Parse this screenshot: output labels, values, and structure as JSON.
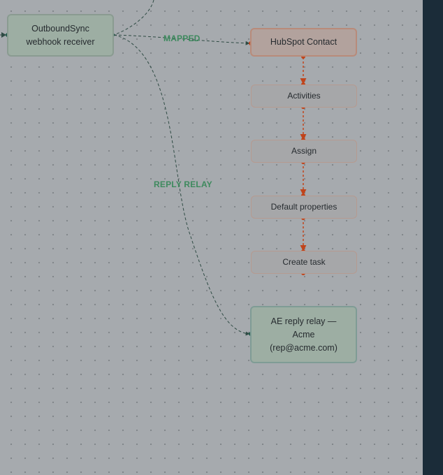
{
  "nodes": {
    "source": "OutboundSync webhook receiver",
    "target": "HubSpot Contact",
    "steps": [
      "Activities",
      "Assign",
      "Default properties",
      "Create task"
    ],
    "relay": "AE reply relay — Acme (rep@acme.com)"
  },
  "edges": {
    "mapped_label": "MAPPED",
    "reply_relay_label": "REPLY RELAY"
  },
  "colors": {
    "canvas": "#a6aaae",
    "rail": "#1b2c39",
    "mapped_edge": "#2f5a4a",
    "chain_edge": "#c0441b",
    "label_green": "#3e8a5e"
  }
}
